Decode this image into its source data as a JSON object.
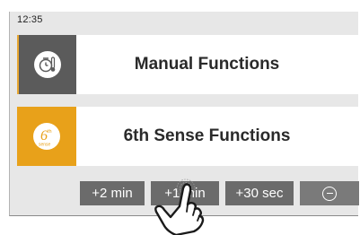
{
  "status_bar": {
    "time": "12:35"
  },
  "tiles": [
    {
      "label": "Manual Functions",
      "icon": "oven-timer-thermometer-icon",
      "icon_bg": "#5b5b5b"
    },
    {
      "label": "6th Sense Functions",
      "icon": "6th-sense-icon",
      "icon_bg": "#e8a11a",
      "icon_text": "6",
      "icon_sup": "th",
      "icon_sub": "sense"
    }
  ],
  "quick_buttons": [
    {
      "label": "+2 min"
    },
    {
      "label": "+1 min"
    },
    {
      "label": "+30 sec"
    },
    {
      "label": "",
      "icon": "minus-circle-icon"
    }
  ],
  "colors": {
    "accent": "#e8a11a",
    "button_bg": "#6b6b6b",
    "screen_bg": "#e7e7e7"
  },
  "overlay": {
    "icon": "pointing-hand-icon"
  }
}
